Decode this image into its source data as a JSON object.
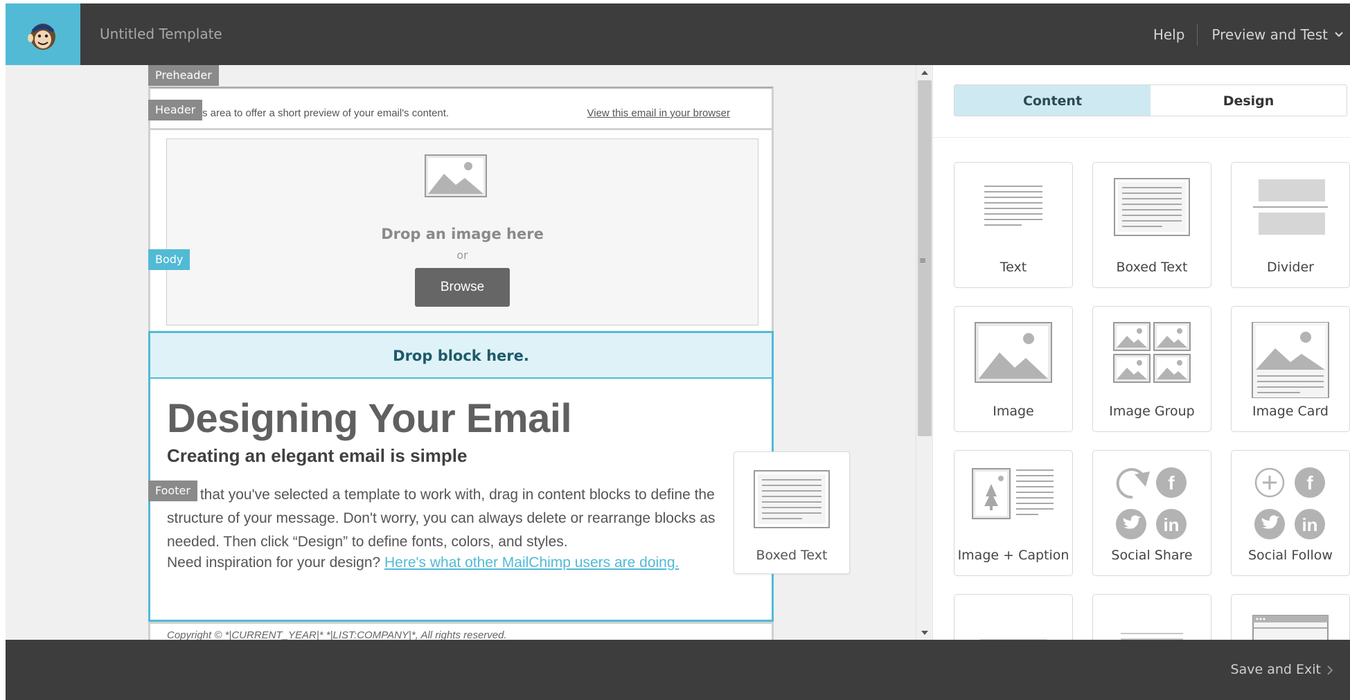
{
  "app": {
    "title": "Untitled Template"
  },
  "topbar": {
    "help": "Help",
    "preview": "Preview and Test"
  },
  "sections": {
    "preheader": "Preheader",
    "header": "Header",
    "body": "Body",
    "footer": "Footer"
  },
  "preheader": {
    "text": "area to offer a short preview of your email's content.",
    "partial_prefix": "s",
    "browser_link": "View this email in your browser"
  },
  "header_block": {
    "drop_text": "Drop an image here",
    "or_text": "or",
    "browse": "Browse"
  },
  "body_block": {
    "drop_zone": "Drop block here.",
    "title": "Designing Your Email",
    "subtitle": "Creating an elegant email is simple",
    "paragraph": "Now that you've selected a template to work with, drag in content blocks to define the structure of your message. Don't worry, you can always delete or rearrange blocks as needed. Then click “Design” to define fonts, colors, and styles.",
    "inspiration_text": "Need inspiration for your design? ",
    "inspiration_link": "Here's what other MailChimp users are doing."
  },
  "footer_block": {
    "copyright": "Copyright © *|CURRENT_YEAR|* *|LIST:COMPANY|*, All rights reserved."
  },
  "drag_ghost": {
    "label": "Boxed Text",
    "icon": "boxed-text-icon"
  },
  "panel": {
    "tabs": [
      {
        "label": "Content",
        "active": true
      },
      {
        "label": "Design",
        "active": false
      }
    ],
    "blocks": [
      {
        "label": "Text",
        "icon": "text-icon"
      },
      {
        "label": "Boxed Text",
        "icon": "boxed-text-icon"
      },
      {
        "label": "Divider",
        "icon": "divider-icon"
      },
      {
        "label": "Image",
        "icon": "image-icon"
      },
      {
        "label": "Image Group",
        "icon": "image-group-icon"
      },
      {
        "label": "Image Card",
        "icon": "image-card-icon"
      },
      {
        "label": "Image + Caption",
        "icon": "image-caption-icon"
      },
      {
        "label": "Social Share",
        "icon": "social-share-icon"
      },
      {
        "label": "Social Follow",
        "icon": "social-follow-icon"
      }
    ]
  },
  "bottombar": {
    "save_exit": "Save and Exit"
  },
  "colors": {
    "accent": "#52bad5",
    "dark_bar": "#3d3d3d",
    "panel_tab_active": "#cfe9f2"
  }
}
